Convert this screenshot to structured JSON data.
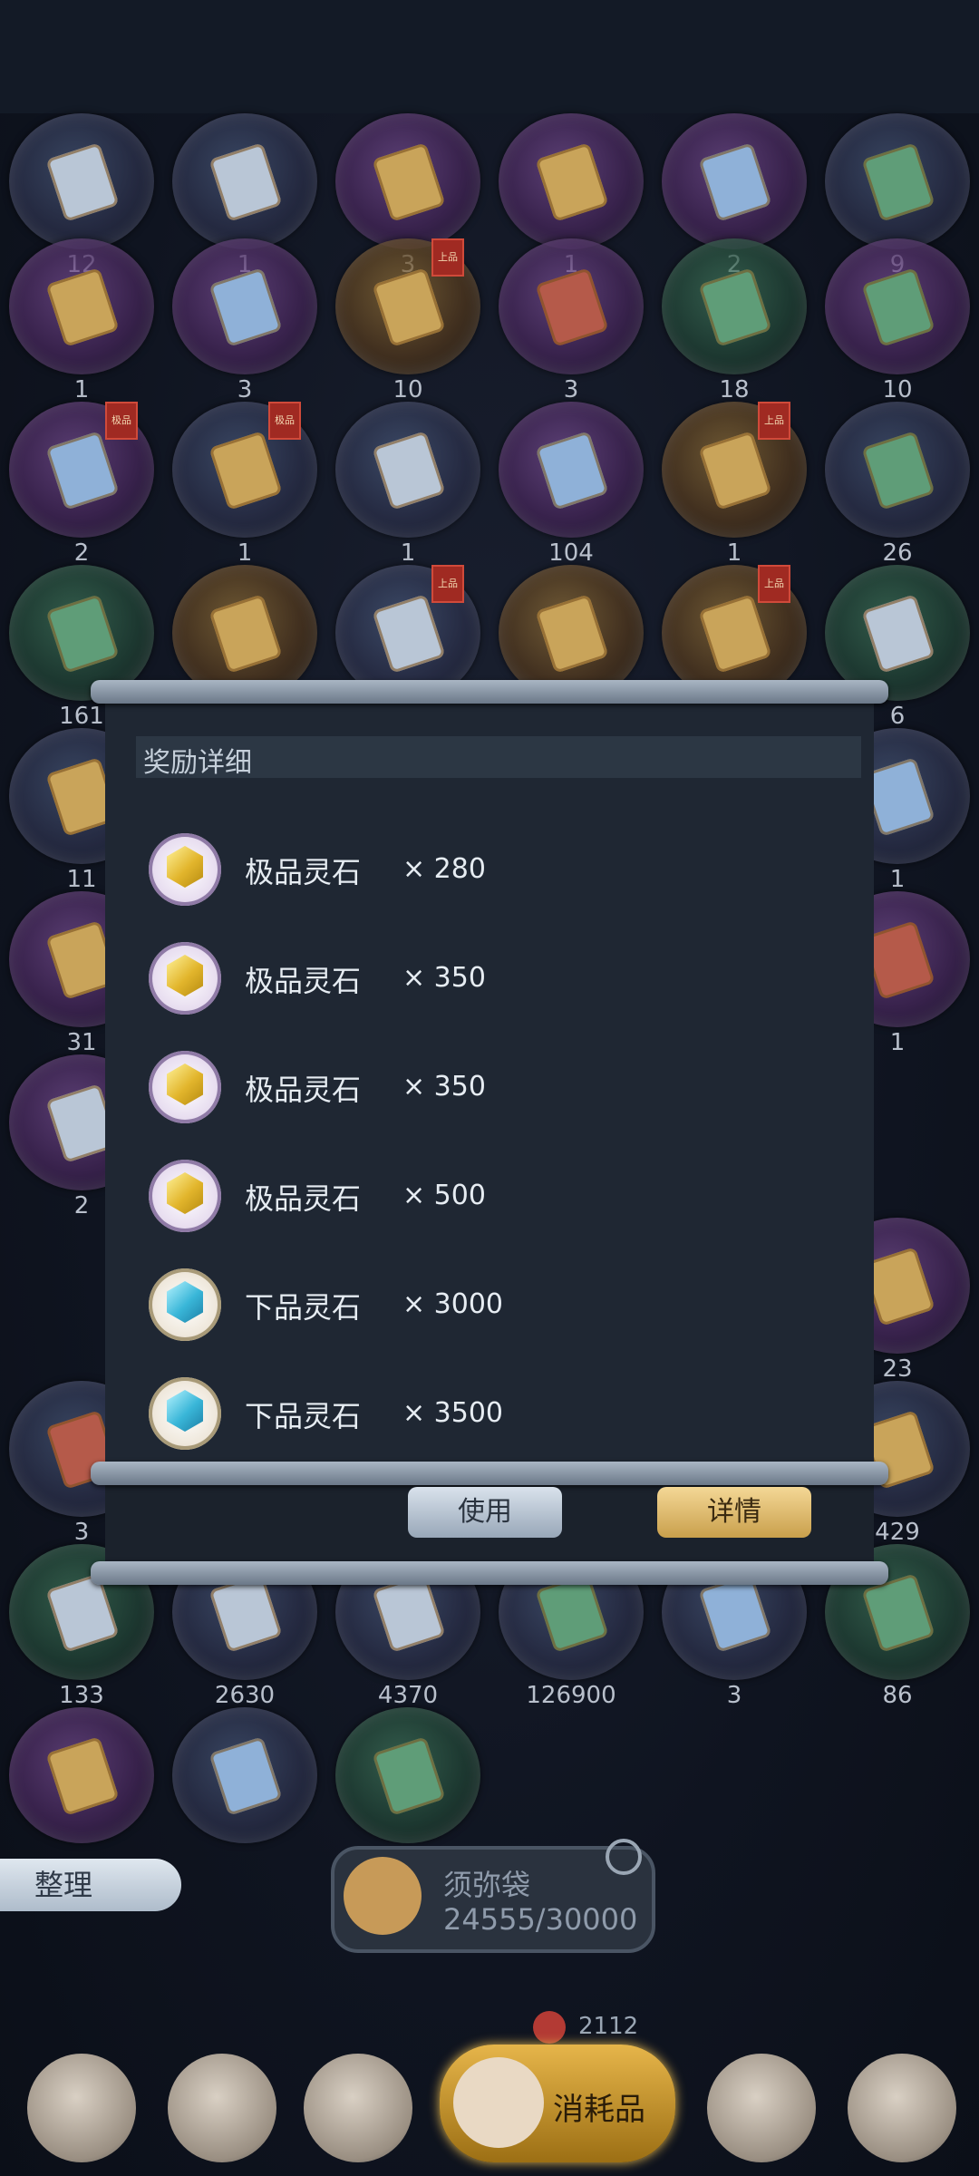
{
  "inventory": {
    "counts_row1": [
      "12",
      "1",
      "3",
      "1",
      "2",
      "9"
    ],
    "counts_row2": [
      "1",
      "3",
      "10",
      "3",
      "18",
      "10"
    ],
    "counts_row3": [
      "2",
      "1",
      "1",
      "104",
      "1",
      "26"
    ],
    "counts_row4": [
      "161",
      "",
      "",
      "",
      "",
      "6"
    ],
    "counts_row5": [
      "11",
      "",
      "",
      "",
      "",
      "1"
    ],
    "counts_row6": [
      "31",
      "",
      "",
      "",
      "",
      "1"
    ],
    "counts_row7": [
      "2",
      "",
      "",
      "",
      "",
      ""
    ],
    "counts_row8": [
      "",
      "",
      "",
      "",
      "",
      "23"
    ],
    "counts_row9": [
      "3",
      "",
      "",
      "",
      "",
      "429"
    ],
    "counts_row10": [
      "133",
      "2630",
      "4370",
      "126900",
      "3",
      "86"
    ],
    "tag_top": "上品",
    "tag_ji": "极品"
  },
  "modal": {
    "title": "奖励详细",
    "rewards": [
      {
        "name": "极品灵石",
        "qty": "× 280"
      },
      {
        "name": "极品灵石",
        "qty": "× 350"
      },
      {
        "name": "极品灵石",
        "qty": "× 350"
      },
      {
        "name": "极品灵石",
        "qty": "× 500"
      },
      {
        "name": "下品灵石",
        "qty": "× 3000"
      },
      {
        "name": "下品灵石",
        "qty": "× 3500"
      }
    ],
    "use_label": "使用",
    "detail_label": "详情"
  },
  "bottom": {
    "sort_label": "整理",
    "bag_title": "须弥袋",
    "bag_capacity": "24555/30000",
    "currency_value": "2112",
    "active_tab_label": "消耗品"
  }
}
